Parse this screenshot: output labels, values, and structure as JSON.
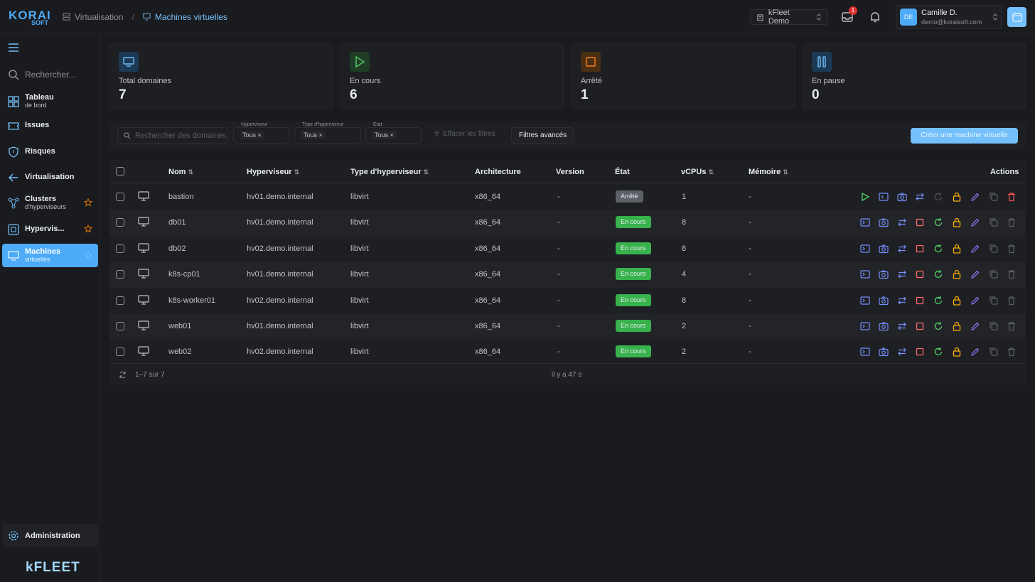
{
  "app": {
    "logo_line1": "KORAI",
    "logo_line2": "SOFT",
    "brand_footer": "kFLEET"
  },
  "breadcrumb": [
    {
      "label": "Virtualisation"
    },
    {
      "label": "Machines virtuelles"
    }
  ],
  "header": {
    "tenant": "kFleet Demo",
    "notification_count": "1",
    "user_initials": "DE",
    "user_name": "Camille D.",
    "user_email": "demo@koraisoft.com"
  },
  "sidebar": {
    "search_placeholder": "Rechercher...",
    "items": [
      {
        "label": "Tableau",
        "sublabel": "de bord",
        "icon": "dashboard-icon"
      },
      {
        "label": "Issues",
        "sublabel": "",
        "icon": "ticket-icon"
      },
      {
        "label": "Risques",
        "sublabel": "",
        "icon": "shield-icon"
      },
      {
        "label": "Virtualisation",
        "sublabel": "",
        "icon": "arrow-left-icon"
      },
      {
        "label": "Clusters",
        "sublabel": "d'hyperviseurs",
        "icon": "cluster-icon"
      },
      {
        "label": "Hypervis...",
        "sublabel": "",
        "icon": "server-icon"
      },
      {
        "label": "Machines",
        "sublabel": "virtuelles",
        "icon": "monitor-icon"
      }
    ],
    "admin_label": "Administration"
  },
  "stats": [
    {
      "label": "Total domaines",
      "value": "7",
      "icon": "monitor-icon",
      "color": "#74c0fc"
    },
    {
      "label": "En cours",
      "value": "6",
      "icon": "play-icon",
      "color": "#51cf66"
    },
    {
      "label": "Arrêté",
      "value": "1",
      "icon": "stop-icon",
      "color": "#fd7e14"
    },
    {
      "label": "En pause",
      "value": "0",
      "icon": "pause-icon",
      "color": "#74c0fc"
    }
  ],
  "filters": {
    "search_placeholder": "Rechercher des domaines...",
    "hyperviseur_label": "Hyperviseur",
    "hyperviseur_value": "Tous",
    "type_label": "Type d'hyperviseur",
    "type_value": "Tous",
    "etat_label": "Etat",
    "etat_value": "Tous",
    "clear_label": "Effacer les filtres",
    "advanced_label": "Filtres avancés",
    "create_label": "Créer une machine virtuelle"
  },
  "table": {
    "columns": [
      "Nom",
      "Hyperviseur",
      "Type d'hyperviseur",
      "Architecture",
      "Version",
      "État",
      "vCPUs",
      "Mémoire",
      "Actions"
    ],
    "rows": [
      {
        "nom": "bastion",
        "hyperviseur": "hv01.demo.internal",
        "type": "libvirt",
        "arch": "x86_64",
        "version": "-",
        "etat": "Arrêté",
        "vcpus": "1",
        "memoire": "-"
      },
      {
        "nom": "db01",
        "hyperviseur": "hv01.demo.internal",
        "type": "libvirt",
        "arch": "x86_64",
        "version": "-",
        "etat": "En cours",
        "vcpus": "8",
        "memoire": "-"
      },
      {
        "nom": "db02",
        "hyperviseur": "hv02.demo.internal",
        "type": "libvirt",
        "arch": "x86_64",
        "version": "-",
        "etat": "En cours",
        "vcpus": "8",
        "memoire": "-"
      },
      {
        "nom": "k8s-cp01",
        "hyperviseur": "hv01.demo.internal",
        "type": "libvirt",
        "arch": "x86_64",
        "version": "-",
        "etat": "En cours",
        "vcpus": "4",
        "memoire": "-"
      },
      {
        "nom": "k8s-worker01",
        "hyperviseur": "hv02.demo.internal",
        "type": "libvirt",
        "arch": "x86_64",
        "version": "-",
        "etat": "En cours",
        "vcpus": "8",
        "memoire": "-"
      },
      {
        "nom": "web01",
        "hyperviseur": "hv01.demo.internal",
        "type": "libvirt",
        "arch": "x86_64",
        "version": "-",
        "etat": "En cours",
        "vcpus": "2",
        "memoire": "-"
      },
      {
        "nom": "web02",
        "hyperviseur": "hv02.demo.internal",
        "type": "libvirt",
        "arch": "x86_64",
        "version": "-",
        "etat": "En cours",
        "vcpus": "2",
        "memoire": "-"
      }
    ],
    "footer_range": "1–7 sur 7",
    "footer_updated": "il y a 47 s"
  }
}
